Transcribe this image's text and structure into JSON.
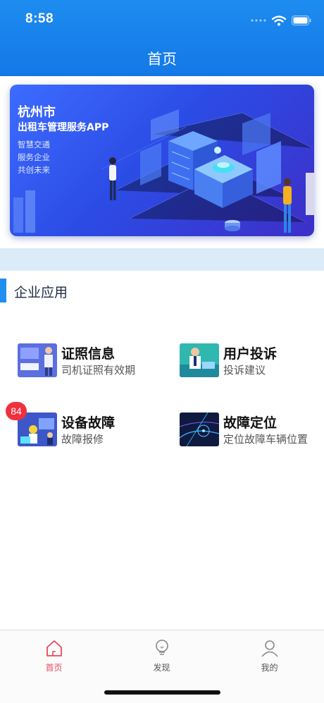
{
  "status_bar": {
    "time": "8:58",
    "wifi_icon": "wifi-icon",
    "battery_icon": "battery-icon"
  },
  "nav": {
    "title": "首页"
  },
  "banner": {
    "city": "杭州市",
    "app_name": "出租车管理服务APP",
    "slogans": [
      "智慧交通",
      "服务企业",
      "共创未来"
    ]
  },
  "section": {
    "title": "企业应用"
  },
  "apps": [
    {
      "title": "证照信息",
      "subtitle": "司机证照有效期"
    },
    {
      "title": "用户投诉",
      "subtitle": "投诉建议"
    },
    {
      "title": "设备故障",
      "subtitle": "故障报修",
      "badge": "84"
    },
    {
      "title": "故障定位",
      "subtitle": "定位故障车辆位置"
    }
  ],
  "tabbar": {
    "items": [
      {
        "label": "首页",
        "icon": "home-icon",
        "active": true
      },
      {
        "label": "发现",
        "icon": "lightbulb-icon",
        "active": false
      },
      {
        "label": "我的",
        "icon": "user-icon",
        "active": false
      }
    ],
    "active_color": "#e8485d"
  },
  "colors": {
    "header": "#1d8cf0",
    "accent": "#1f8ff0",
    "badge": "#f0303e"
  }
}
